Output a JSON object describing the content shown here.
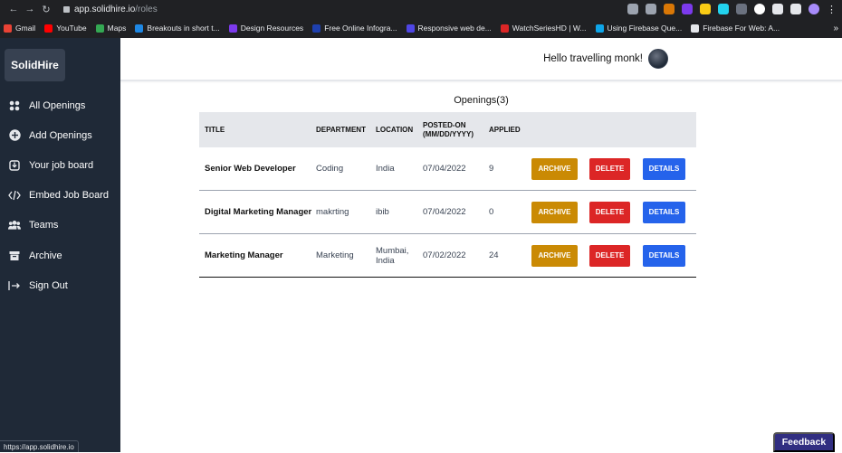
{
  "browser": {
    "url_host": "app.solidhire.io",
    "url_path": "/roles",
    "bookmarks": [
      {
        "label": "Gmail",
        "color": "#ea4335"
      },
      {
        "label": "YouTube",
        "color": "#ff0000"
      },
      {
        "label": "Maps",
        "color": "#34a853"
      },
      {
        "label": "Breakouts in short t...",
        "color": "#1e88e5"
      },
      {
        "label": "Design Resources",
        "color": "#7c3aed"
      },
      {
        "label": "Free Online Infogra...",
        "color": "#1e40af"
      },
      {
        "label": "Responsive web de...",
        "color": "#4f46e5"
      },
      {
        "label": "WatchSeriesHD | W...",
        "color": "#dc2626"
      },
      {
        "label": "Using Firebase Que...",
        "color": "#0ea5e9"
      },
      {
        "label": "Firebase For Web: A...",
        "color": "#e5e7eb"
      }
    ],
    "status_url": "https://app.solidhire.io"
  },
  "sidebar": {
    "brand": "SolidHire",
    "items": [
      {
        "label": "All Openings",
        "icon": "grid-icon"
      },
      {
        "label": "Add Openings",
        "icon": "plus-circle-icon"
      },
      {
        "label": "Your job board",
        "icon": "download-box-icon"
      },
      {
        "label": "Embed Job Board",
        "icon": "code-icon"
      },
      {
        "label": "Teams",
        "icon": "users-icon"
      },
      {
        "label": "Archive",
        "icon": "archive-icon"
      },
      {
        "label": "Sign Out",
        "icon": "sign-out-icon"
      }
    ]
  },
  "header": {
    "greeting": "Hello travelling monk!"
  },
  "openings": {
    "title": "Openings(3)",
    "columns": [
      "TITLE",
      "DEPARTMENT",
      "LOCATION",
      "POSTED-ON (MM/DD/YYYY)",
      "APPLIED"
    ],
    "rows": [
      {
        "title": "Senior Web Developer",
        "department": "Coding",
        "location": "India",
        "posted": "07/04/2022",
        "applied": "9"
      },
      {
        "title": "Digital Marketing Manager",
        "department": "makrting",
        "location": "ibib",
        "posted": "07/04/2022",
        "applied": "0"
      },
      {
        "title": "Marketing Manager",
        "department": "Marketing",
        "location": "Mumbai, India",
        "posted": "07/02/2022",
        "applied": "24"
      }
    ],
    "actions": {
      "archive": "ARCHIVE",
      "delete": "DELETE",
      "details": "DETAILS"
    }
  },
  "feedback_label": "Feedback",
  "colors": {
    "sidebar_bg": "#1f2937",
    "archive": "#ca8a04",
    "delete": "#dc2626",
    "details": "#2563eb",
    "feedback": "#312e81"
  }
}
